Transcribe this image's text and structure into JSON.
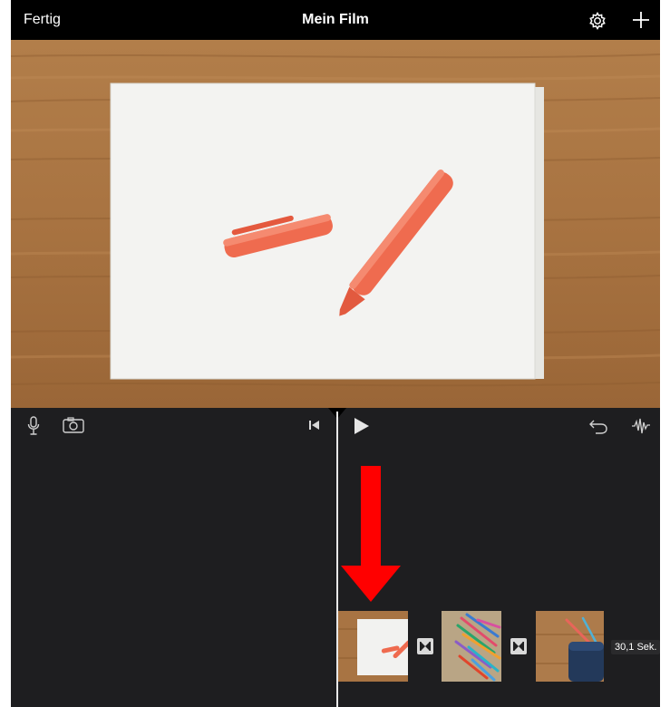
{
  "header": {
    "done_label": "Fertig",
    "title": "Mein Film",
    "settings_icon": "gear-icon",
    "add_icon": "plus-icon"
  },
  "toolbar": {
    "icons": [
      "microphone-icon",
      "camera-icon",
      "skip-to-start-icon",
      "play-icon",
      "undo-icon",
      "audio-waveform-icon"
    ]
  },
  "timeline": {
    "clips": [
      {
        "name": "clip-paper-pen"
      },
      {
        "name": "clip-colored-pencils"
      },
      {
        "name": "clip-pencil-case"
      }
    ],
    "transition_icon": "bowtie-icon",
    "duration_label": "30,1 Sek."
  },
  "annotation": {
    "arrow_color": "#ff0000"
  },
  "colors": {
    "timeline_bg": "#1e1e20",
    "header_bg": "#000000",
    "playhead": "#e9e9e9"
  }
}
